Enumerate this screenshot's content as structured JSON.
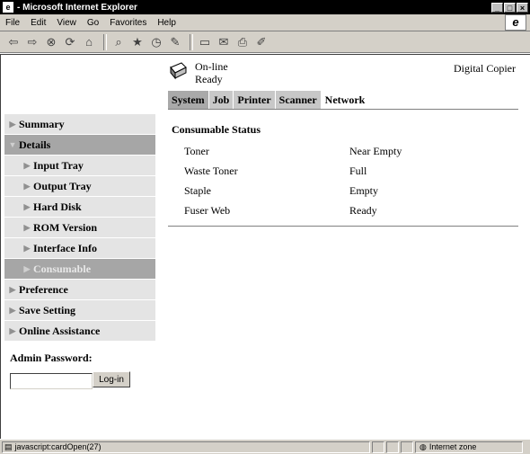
{
  "window": {
    "title": " - Microsoft Internet Explorer",
    "controls": [
      "_",
      "□",
      "×"
    ]
  },
  "menubar": {
    "items": [
      "File",
      "Edit",
      "View",
      "Go",
      "Favorites",
      "Help"
    ]
  },
  "toolbar": {
    "icons": [
      "back-icon",
      "forward-icon",
      "stop-icon",
      "refresh-icon",
      "home-icon",
      "search-icon",
      "favorites-icon",
      "history-icon",
      "channels-icon",
      "fullscreen-icon",
      "mail-icon",
      "print-icon",
      "edit-icon"
    ]
  },
  "device": {
    "status_line1": "On-line",
    "status_line2": "Ready",
    "name": "Digital Copier"
  },
  "tabs": [
    {
      "label": "System"
    },
    {
      "label": "Job"
    },
    {
      "label": "Printer"
    },
    {
      "label": "Scanner"
    },
    {
      "label": "Network"
    }
  ],
  "sidebar": {
    "items": [
      {
        "label": "Summary"
      },
      {
        "label": "Details"
      },
      {
        "label": "Input Tray"
      },
      {
        "label": "Output Tray"
      },
      {
        "label": "Hard Disk"
      },
      {
        "label": "ROM Version"
      },
      {
        "label": "Interface Info"
      },
      {
        "label": "Consumable"
      },
      {
        "label": "Preference"
      },
      {
        "label": "Save Setting"
      },
      {
        "label": "Online Assistance"
      }
    ]
  },
  "admin": {
    "label": "Admin Password:",
    "password_value": "",
    "login_label": "Log-in"
  },
  "consumable": {
    "title": "Consumable Status",
    "rows": [
      {
        "item": "Toner",
        "value": "Near Empty"
      },
      {
        "item": "Waste Toner",
        "value": "Full"
      },
      {
        "item": "Staple",
        "value": "Empty"
      },
      {
        "item": "Fuser Web",
        "value": "Ready"
      }
    ]
  },
  "statusbar": {
    "text": "javascript:cardOpen(27)",
    "zone": "Internet zone"
  },
  "colors": {
    "sidebar_bg": "#e4e4e4",
    "sidebar_active": "#a6a6a6",
    "tab_active": "#a9a9a9",
    "chrome": "#d4d0c8"
  }
}
